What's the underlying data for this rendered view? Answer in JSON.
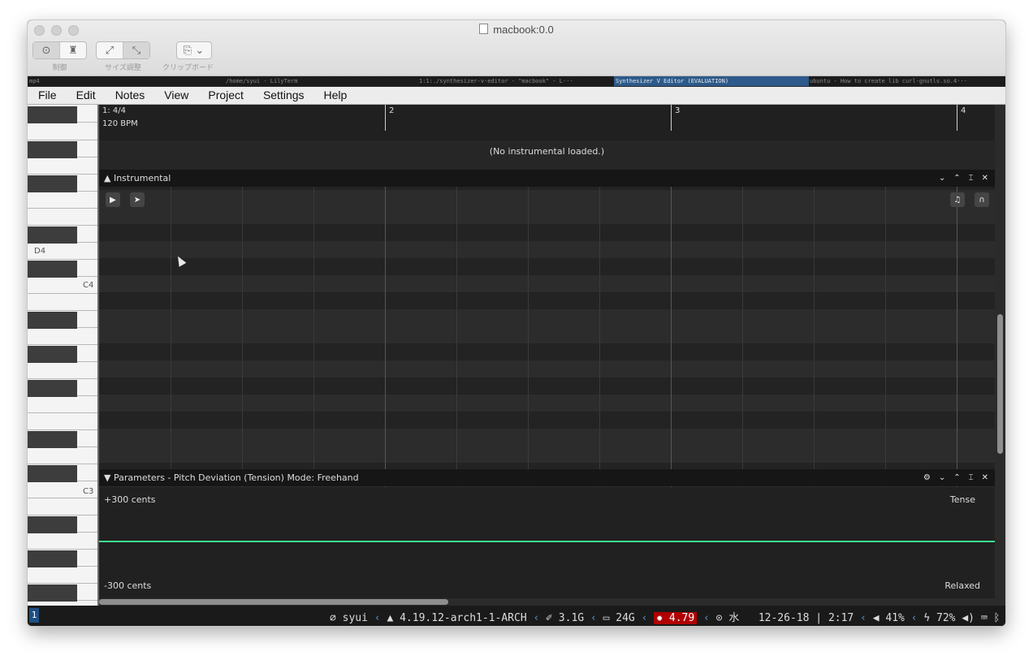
{
  "window": {
    "title": "macbook:0.0",
    "toolbar": {
      "control_label": "制御",
      "resize_label": "サイズ調整",
      "clipboard_label": "クリップボード"
    }
  },
  "tmux_tabs": [
    "mp4",
    "/home/syui - LilyTerm",
    "1:1:./synthesizer-v-editor - \"macbook\" - L···",
    "Synthesizer V Editor (EVALUATION)",
    "ubuntu - How to create lib curl-gnutls.so.4···"
  ],
  "menu": [
    "File",
    "Edit",
    "Notes",
    "View",
    "Project",
    "Settings",
    "Help"
  ],
  "ruler": {
    "time_signature": "1: 4/4",
    "tempo": "120 BPM",
    "bars": [
      "2",
      "3",
      "4"
    ]
  },
  "instrumental": {
    "message": "(No instrumental loaded.)",
    "header": "Instrumental",
    "header_arrow": "▲"
  },
  "piano_labels": {
    "d4": "D4",
    "c4": "C4",
    "c3": "C3"
  },
  "parameters": {
    "header": "Parameters - Pitch Deviation (Tension) Mode: Freehand",
    "header_arrow": "▼",
    "top_value": "+300 cents",
    "bottom_value": "-300 cents",
    "top_label": "Tense",
    "bottom_label": "Relaxed",
    "curve_level_fraction": 0.5
  },
  "status_bar": {
    "workspace": "1",
    "user": "syui",
    "kernel": "4.19.12-arch1-1-ARCH",
    "memory": "3.1G",
    "disk": "24G",
    "load": "4.79",
    "weekday": "水",
    "date": "12-26-18",
    "separator": "|",
    "time": "2:17",
    "volume": "41%",
    "battery": "72%"
  },
  "colors": {
    "accent_blue": "#1e4f84",
    "curve_green": "#3fdc8f",
    "warning_red": "#b00000"
  }
}
